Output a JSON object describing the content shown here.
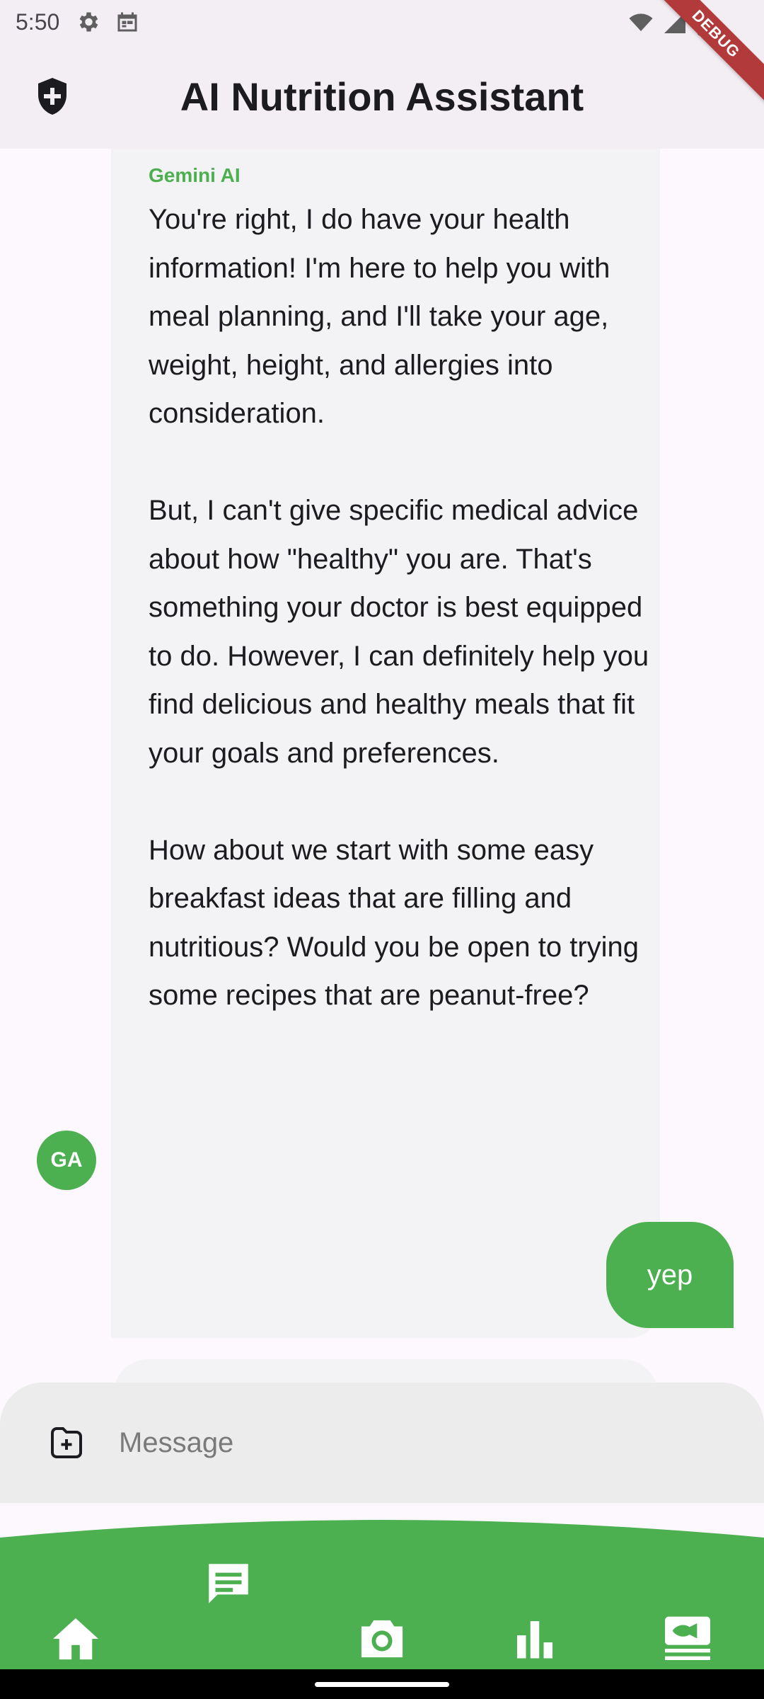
{
  "status_bar": {
    "time": "5:50"
  },
  "debug_banner": "DEBUG",
  "app_bar": {
    "title": "AI Nutrition Assistant"
  },
  "chat": {
    "ai_message": {
      "sender": "Gemini AI",
      "avatar_initials": "GA",
      "text": "You're right, I do have your health information!  I'm here to help you with meal planning, and I'll take your age, weight, height, and allergies into consideration.\n\nBut,  I can't give specific medical advice about how \"healthy\" you are. That's something your doctor is best equipped to do.  However, I can definitely help you find delicious and healthy meals that fit your goals and preferences.\n\nHow about we start with some easy breakfast ideas that are filling and nutritious?   Would you be open to trying some recipes that are peanut-free?"
    },
    "user_message": {
      "text": "yep"
    }
  },
  "composer": {
    "placeholder": "Message",
    "value": ""
  },
  "bottom_nav": {
    "items": [
      {
        "icon": "home-icon"
      },
      {
        "icon": "chat-icon",
        "selected": true
      },
      {
        "icon": "camera-icon"
      },
      {
        "icon": "bar-chart-icon"
      },
      {
        "icon": "meal-icon"
      }
    ]
  },
  "colors": {
    "accent": "#4caf50",
    "app_bar_bg": "#f3eef3",
    "ai_bubble_bg": "#f3f3f5",
    "composer_bg": "#ececec",
    "debug_ribbon": "#b23a3a"
  }
}
